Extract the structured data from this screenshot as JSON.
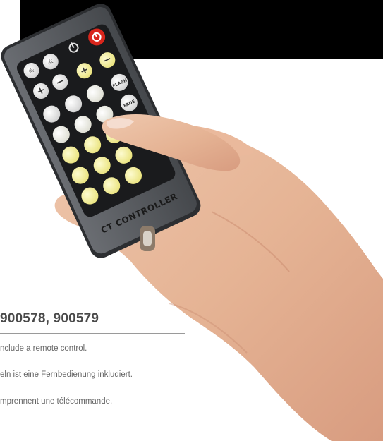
{
  "heading": {
    "models": "900578, 900579"
  },
  "notes": {
    "english": "nclude a remote control.",
    "german": "eln ist eine Fernbedienung inkludiert.",
    "french": "mprennent une télécommande."
  },
  "remote": {
    "label": "CT CONTROLLER",
    "flash_key": "FLASH",
    "fade_key": "FADE",
    "icons": [
      "power-outline-icon",
      "power-red-icon",
      "brightness-up-icon",
      "brightness-down-icon",
      "plus-icon",
      "minus-icon"
    ]
  },
  "colors": {
    "remote_body": "#55585d",
    "power_key": "#d9261c",
    "warm_key": "#f6f2a0",
    "cool_key": "#f1f1ea",
    "skin": "#e6b59a"
  }
}
